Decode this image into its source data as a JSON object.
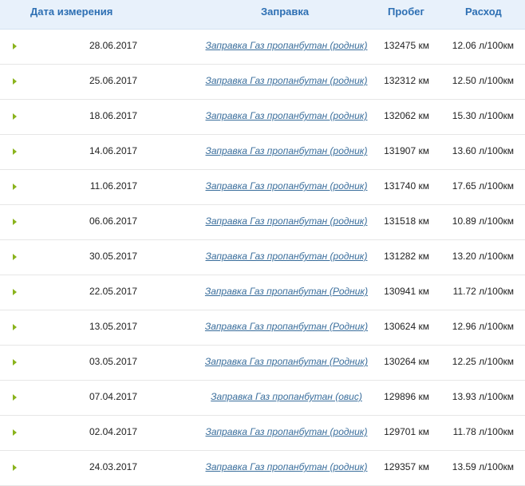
{
  "header": {
    "date": "Дата измерения",
    "fuel": "Заправка",
    "mileage": "Пробег",
    "consumption": "Расход"
  },
  "rows": [
    {
      "date": "28.06.2017",
      "fuel": "Заправка Газ пропанбутан (родник)",
      "mileage": "132475 км",
      "consumption": "12.06 л/100км"
    },
    {
      "date": "25.06.2017",
      "fuel": "Заправка Газ пропанбутан (родник)",
      "mileage": "132312 км",
      "consumption": "12.50 л/100км"
    },
    {
      "date": "18.06.2017",
      "fuel": "Заправка Газ пропанбутан (родник)",
      "mileage": "132062 км",
      "consumption": "15.30 л/100км"
    },
    {
      "date": "14.06.2017",
      "fuel": "Заправка Газ пропанбутан (родник)",
      "mileage": "131907 км",
      "consumption": "13.60 л/100км"
    },
    {
      "date": "11.06.2017",
      "fuel": "Заправка Газ пропанбутан (родник)",
      "mileage": "131740 км",
      "consumption": "17.65 л/100км"
    },
    {
      "date": "06.06.2017",
      "fuel": "Заправка Газ пропанбутан (родник)",
      "mileage": "131518 км",
      "consumption": "10.89 л/100км"
    },
    {
      "date": "30.05.2017",
      "fuel": "Заправка Газ пропанбутан (родник)",
      "mileage": "131282 км",
      "consumption": "13.20 л/100км"
    },
    {
      "date": "22.05.2017",
      "fuel": "Заправка Газ пропанбутан (Родник)",
      "mileage": "130941 км",
      "consumption": "11.72 л/100км"
    },
    {
      "date": "13.05.2017",
      "fuel": "Заправка Газ пропанбутан (Родник)",
      "mileage": "130624 км",
      "consumption": "12.96 л/100км"
    },
    {
      "date": "03.05.2017",
      "fuel": "Заправка Газ пропанбутан (Родник)",
      "mileage": "130264 км",
      "consumption": "12.25 л/100км"
    },
    {
      "date": "07.04.2017",
      "fuel": "Заправка Газ пропанбутан (овис)",
      "mileage": "129896 км",
      "consumption": "13.93 л/100км"
    },
    {
      "date": "02.04.2017",
      "fuel": "Заправка Газ пропанбутан (родник)",
      "mileage": "129701 км",
      "consumption": "11.78 л/100км"
    },
    {
      "date": "24.03.2017",
      "fuel": "Заправка Газ пропанбутан (родник)",
      "mileage": "129357 км",
      "consumption": "13.59 л/100км"
    }
  ],
  "colors": {
    "header_bg": "#e8f1fb",
    "header_text": "#2d6fb3",
    "link": "#3a6e9c",
    "arrow": "#8ab31c"
  }
}
